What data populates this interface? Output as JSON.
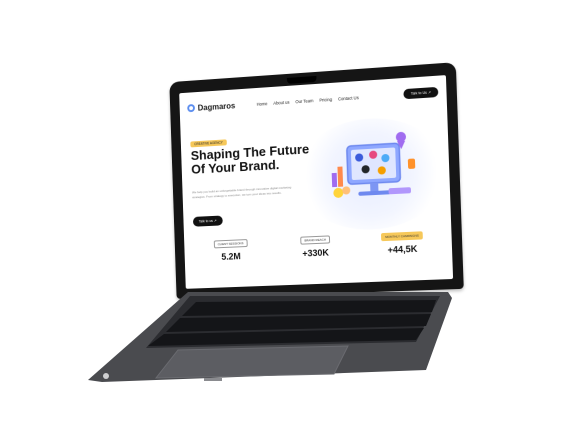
{
  "site": {
    "brand": "Dagmaros",
    "nav_items": [
      "Home",
      "About us",
      "Our Team",
      "Pricing",
      "Contact Us"
    ],
    "cta_label": "Talk to Us ↗",
    "hero_tag": "CREATIVE AGENCY",
    "hero_title": "Shaping The Future Of Your Brand.",
    "hero_text": "We help you build an unforgettable brand through innovative digital marketing strategies. From strategy to execution, we turn your ideas into results.",
    "hero_button": "Talk to us ↗",
    "stats": [
      {
        "label": "CLIENT SESSIONS",
        "value": "5.2M",
        "highlight": false
      },
      {
        "label": "BRAND REACH",
        "value": "+330K",
        "highlight": false
      },
      {
        "label": "MONTHLY CAMPAIGNS",
        "value": "+44,5K",
        "highlight": true
      }
    ]
  },
  "colors": {
    "accent_yellow": "#f6c85a",
    "dark": "#111111",
    "primary_blue": "#5b8def",
    "illustration_blue": "#8ea7ff",
    "illustration_purple": "#a06cf0",
    "illustration_orange": "#ff8a4c"
  }
}
